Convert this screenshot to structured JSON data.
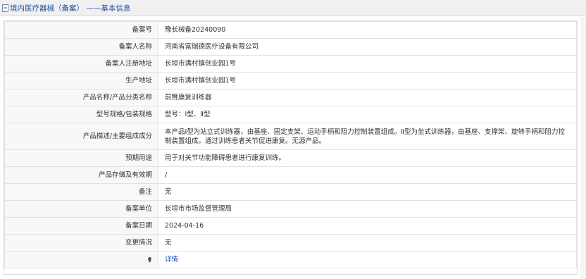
{
  "header": {
    "title": "境内医疗器械（备案） ——基本信息"
  },
  "rows": [
    {
      "label": "备案号",
      "value": "豫长械备20240090"
    },
    {
      "label": "备案人名称",
      "value": "河南省富瑞德医疗设备有限公司"
    },
    {
      "label": "备案人注册地址",
      "value": "长垣市满村镇创业园1号"
    },
    {
      "label": "生产地址",
      "value": "长垣市满村镇创业园1号"
    },
    {
      "label": "产品名称/产品分类名称",
      "value": "前臂康复训练器"
    },
    {
      "label": "型号规格/包装规格",
      "value": "型号：Ⅰ型、Ⅱ型"
    },
    {
      "label": "产品描述/主要组成成分",
      "value": "本产品Ⅰ型为站立式训练器，由基座、固定支架、运动手柄和阻力控制装置组成。Ⅱ型为坐式训练器，由基座、支撑架、旋转手柄和阻力控制装置组成。通过训练患者关节促进康复。无源产品。"
    },
    {
      "label": "预期用途",
      "value": "用于对关节功能障碍患者进行康复训练。"
    },
    {
      "label": "产品存储及有效期",
      "value": "/"
    },
    {
      "label": "备注",
      "value": "无"
    },
    {
      "label": "备案单位",
      "value": "长垣市市场监督管理局"
    },
    {
      "label": "备案日期",
      "value": "2024-04-16"
    },
    {
      "label": "变更情况",
      "value": "无"
    }
  ],
  "footer_row": {
    "icon": "pin-icon",
    "link_label": "详情"
  },
  "colors": {
    "link": "#1e50a2",
    "label_bg": "#f8f8f8",
    "border": "#e2e2e2"
  }
}
